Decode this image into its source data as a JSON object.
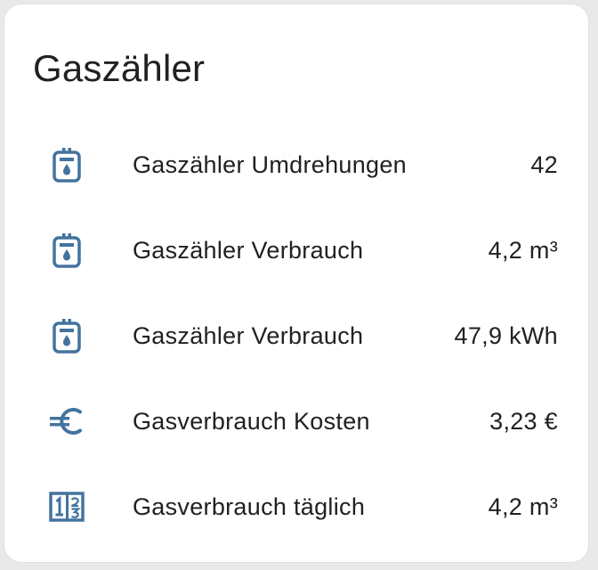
{
  "card": {
    "title": "Gaszähler"
  },
  "colors": {
    "icon": "#44739e",
    "text": "#212121",
    "card_background": "#ffffff"
  },
  "entities": [
    {
      "icon": "meter-gas-icon",
      "name": "Gaszähler Umdrehungen",
      "state": "42"
    },
    {
      "icon": "meter-gas-icon",
      "name": "Gaszähler Verbrauch",
      "state": "4,2 m³"
    },
    {
      "icon": "meter-gas-icon",
      "name": "Gaszähler Verbrauch",
      "state": "47,9 kWh"
    },
    {
      "icon": "currency-eur-icon",
      "name": "Gasverbrauch Kosten",
      "state": "3,23 €"
    },
    {
      "icon": "fraction-icon",
      "name": "Gasverbrauch täglich",
      "state": "4,2 m³"
    }
  ]
}
